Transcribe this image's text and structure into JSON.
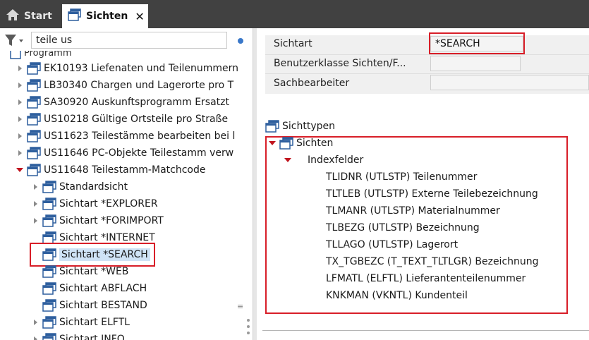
{
  "tabs": {
    "start_label": "Start",
    "sichten_label": "Sichten",
    "close_glyph": "✕"
  },
  "search": {
    "value": "teile us"
  },
  "tree": {
    "top_partial": "Programm",
    "programs": [
      "EK10193 Liefenaten und Teilenummern",
      "LB30340 Chargen und Lagerorte pro T",
      "SA30920 Auskunftsprogramm Ersatzt",
      "US10218 Gültige Ortsteile pro Straße",
      "US11623 Teilestämme bearbeiten bei l",
      "US11646 PC-Objekte Teilestamm verw",
      "US11648 Teilestamm-Matchcode"
    ],
    "children": [
      "Standardsicht",
      "Sichtart *EXPLORER",
      "Sichtart *FORIMPORT",
      "Sichtart *INTERNET",
      "Sichtart *SEARCH",
      "Sichtart *WEB",
      "Sichtart ABFLACH",
      "Sichtart BESTAND",
      "Sichtart ELFTL",
      "Sichtart INFO"
    ]
  },
  "form": {
    "sichtart_label": "Sichtart",
    "sichtart_value": "*SEARCH",
    "benutzerklasse_label": "Benutzerklasse Sichten/F...",
    "benutzerklasse_value": "",
    "sachbearbeiter_label": "Sachbearbeiter",
    "sachbearbeiter_value": ""
  },
  "detail_tree": {
    "sichttypen": "Sichttypen",
    "sichten": "Sichten",
    "indexfelder": "Indexfelder",
    "fields": [
      "TLIDNR (UTLSTP) Teilenummer",
      "TLTLEB (UTLSTP) Externe Teilebezeichnung",
      "TLMANR (UTLSTP) Materialnummer",
      "TLBEZG (UTLSTP) Bezeichnung",
      "TLLAGO (UTLSTP) Lagerort",
      "TX_TGBEZC (T_TEXT_TLTLGR) Bezeichnung",
      "LFMATL (ELFTL) Lieferantenteilenummer",
      "KNKMAN (VKNTL) Kundenteil"
    ]
  },
  "colors": {
    "tabbar": "#414141",
    "highlight_box": "#d81e28",
    "selection": "#cfe3f6",
    "expand_arrow": "#c0141e",
    "status_dot": "#3a78c9"
  },
  "icons": [
    "home-icon",
    "view-icon",
    "filter-icon",
    "close-icon",
    "expand-arrow-icon",
    "collapse-arrow-icon"
  ]
}
